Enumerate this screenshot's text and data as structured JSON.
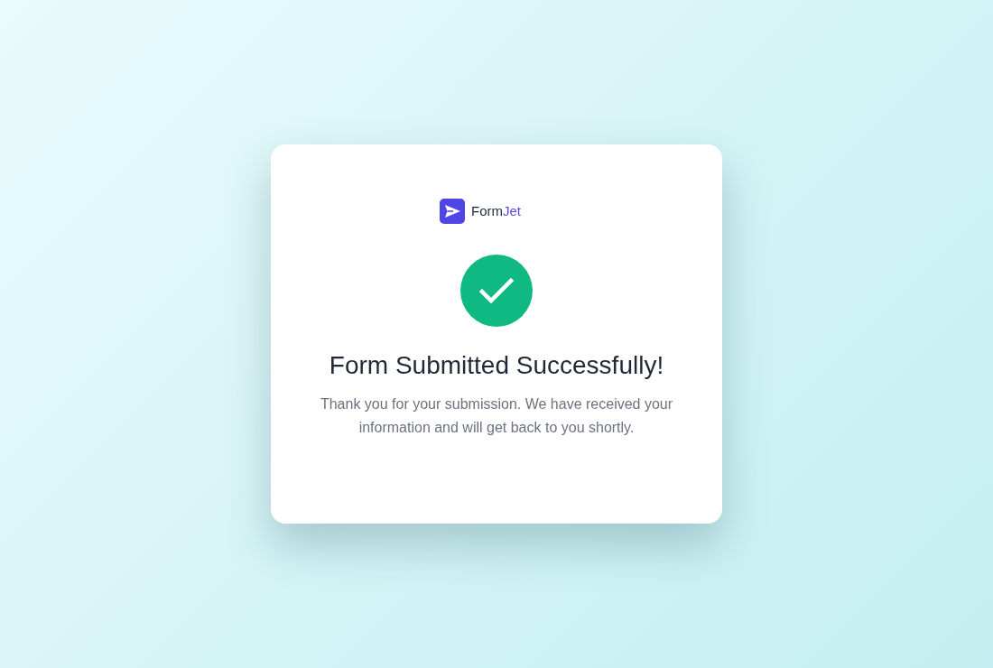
{
  "logo": {
    "name": "Form",
    "accent": "Jet"
  },
  "confirmation": {
    "title": "Form Submitted Successfully!",
    "message": "Thank you for your submission. We have received your information and will get back to you shortly."
  }
}
